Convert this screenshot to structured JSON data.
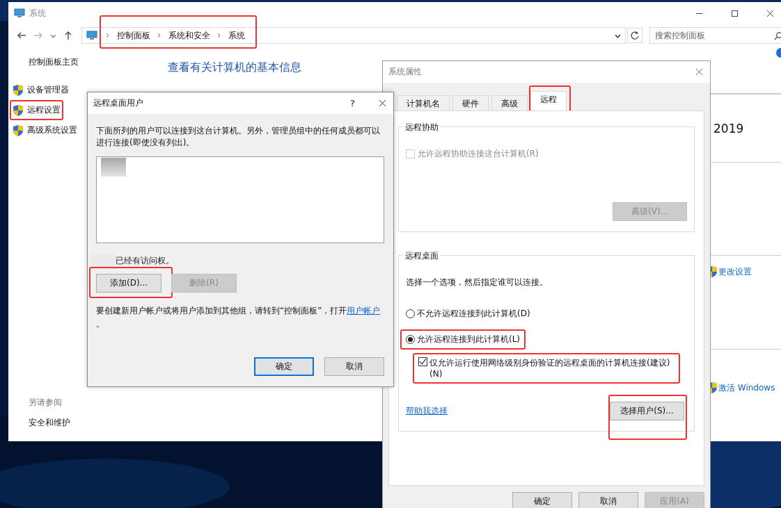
{
  "system_window": {
    "title": "系统",
    "breadcrumb": [
      {
        "label": "控制面板"
      },
      {
        "label": "系统和安全"
      },
      {
        "label": "系统"
      }
    ],
    "breadcrumb_highlighted": true,
    "search": {
      "placeholder": "搜索控制面板"
    },
    "sidebar": {
      "home": "控制面板主页",
      "items": [
        {
          "label": "设备管理器",
          "highlighted": false
        },
        {
          "label": "远程设置",
          "highlighted": true
        },
        {
          "label": "高级系统设置",
          "highlighted": false
        }
      ],
      "see_also_heading": "另请参阅",
      "see_also_links": [
        "安全和维护"
      ]
    },
    "heading": "查看有关计算机的基本信息",
    "edition_fragment": "2019",
    "links": [
      {
        "label": "更改设置"
      },
      {
        "label": "激活 Windows"
      }
    ]
  },
  "remote_users_dialog": {
    "title": "远程桌面用户",
    "help": "?",
    "description": "下面所列的用户可以连接到这台计算机。另外，管理员组中的任何成员都可以进行连接(即使没有列出)。",
    "access_note": "已经有访问权。",
    "buttons": [
      {
        "label": "添加(D)...",
        "disabled": false,
        "highlighted": true
      },
      {
        "label": "删除(R)",
        "disabled": true,
        "highlighted": false
      }
    ],
    "hint": "要创建新用户帐户或将用户添加到其他组，请转到“控制面板”，打开",
    "hint_link": "用户帐户",
    "hint_end": "。",
    "footer_buttons": [
      {
        "label": "确定",
        "default": true
      },
      {
        "label": "取消",
        "default": false
      }
    ]
  },
  "system_properties_dialog": {
    "title": "系统属性",
    "tabs": [
      {
        "label": "计算机名",
        "selected": false,
        "highlighted": false
      },
      {
        "label": "硬件",
        "selected": false,
        "highlighted": false
      },
      {
        "label": "高级",
        "selected": false,
        "highlighted": false
      },
      {
        "label": "远程",
        "selected": true,
        "highlighted": true
      }
    ],
    "remote_assistance": {
      "title": "远程协助",
      "checkbox": {
        "label": "允许远程协助连接这台计算机(R)",
        "checked": false,
        "disabled": true
      },
      "advanced_button": {
        "label": "高级(V)...",
        "disabled": true
      }
    },
    "remote_desktop": {
      "title": "远程桌面",
      "instruction": "选择一个选项，然后指定谁可以连接。",
      "options": [
        {
          "kind": "radio",
          "label": "不允许远程连接到此计算机(D)",
          "selected": false,
          "highlighted": false
        },
        {
          "kind": "radio",
          "label": "允许远程连接到此计算机(L)",
          "selected": true,
          "highlighted": true
        },
        {
          "kind": "checkbox",
          "label": "仅允许运行使用网络级别身份验证的远程桌面的计算机连接(建议)(N)",
          "checked": true,
          "highlighted": true
        }
      ],
      "help_link": "帮助我选择",
      "select_users_button": {
        "label": "选择用户(S)...",
        "highlighted": true
      }
    },
    "footer_buttons": [
      {
        "label": "确定",
        "disabled": false
      },
      {
        "label": "取消",
        "disabled": false
      },
      {
        "label": "应用(A)",
        "disabled": true
      }
    ]
  }
}
